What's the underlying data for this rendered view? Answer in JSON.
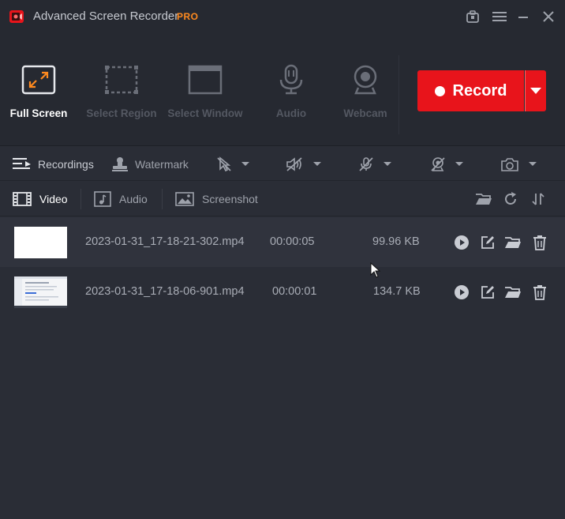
{
  "titlebar": {
    "title": "Advanced Screen Recorder",
    "badge": "PRO",
    "icons": [
      "toolbox-icon",
      "menu-icon",
      "minimize-icon",
      "close-icon"
    ]
  },
  "modes": [
    {
      "label": "Full Screen",
      "icon": "fullscreen-icon",
      "active": true
    },
    {
      "label": "Select Region",
      "icon": "region-icon",
      "active": false
    },
    {
      "label": "Select Window",
      "icon": "window-icon",
      "active": false
    },
    {
      "label": "Audio",
      "icon": "microphone-icon",
      "active": false
    },
    {
      "label": "Webcam",
      "icon": "webcam-icon",
      "active": false
    }
  ],
  "record": {
    "label": "Record"
  },
  "toolbar": {
    "recordings": "Recordings",
    "watermark": "Watermark"
  },
  "tabs": [
    {
      "label": "Video",
      "active": true
    },
    {
      "label": "Audio",
      "active": false
    },
    {
      "label": "Screenshot",
      "active": false
    }
  ],
  "recordings": [
    {
      "name": "2023-01-31_17-18-21-302.mp4",
      "duration": "00:00:05",
      "size": "99.96 KB",
      "thumb": "blank"
    },
    {
      "name": "2023-01-31_17-18-06-901.mp4",
      "duration": "00:00:01",
      "size": "134.7 KB",
      "thumb": "screenshot"
    }
  ],
  "colors": {
    "accent": "#e8141b",
    "pro": "#ff8a1f",
    "background": "#2a2d36",
    "header": "#262931"
  }
}
